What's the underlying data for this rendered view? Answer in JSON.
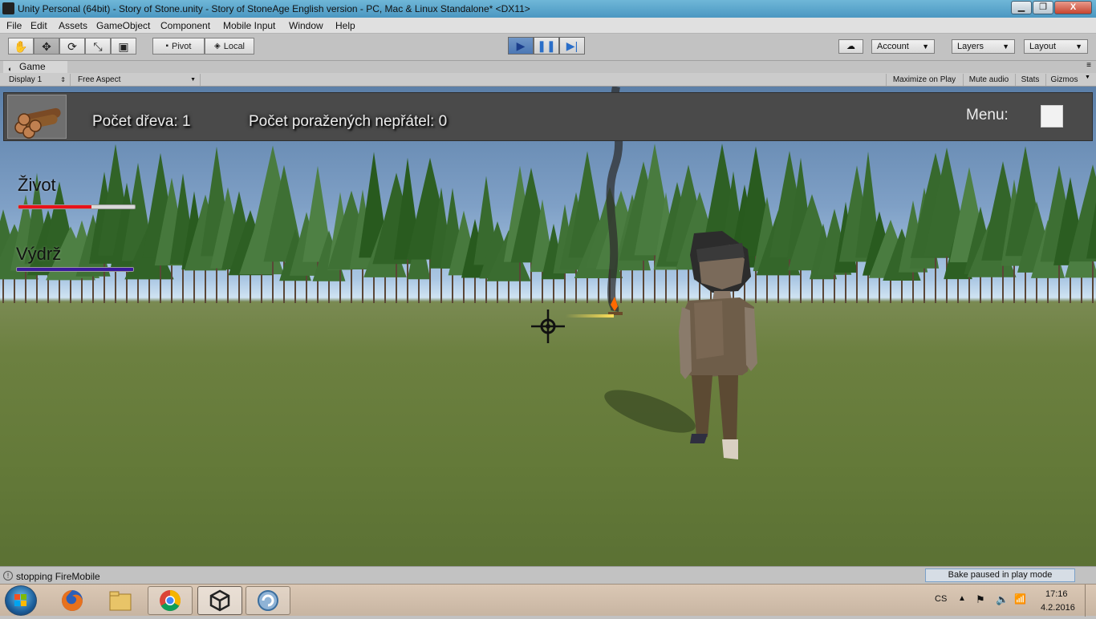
{
  "window": {
    "title": "Unity Personal (64bit) - Story of Stone.unity - Story of StoneAge English version - PC, Mac & Linux Standalone* <DX11>",
    "minimize": "▁",
    "maximize": "❐",
    "close": "X"
  },
  "menu": [
    "File",
    "Edit",
    "Assets",
    "GameObject",
    "Component",
    "Mobile Input",
    "Window",
    "Help"
  ],
  "toolbar": {
    "tools": [
      "hand-icon",
      "move-icon",
      "rotate-icon",
      "scale-icon",
      "rect-icon"
    ],
    "pivot_label": "Pivot",
    "local_label": "Local",
    "account_label": "Account",
    "layers_label": "Layers",
    "layout_label": "Layout"
  },
  "game_tab": {
    "label": "Game",
    "display": "Display 1",
    "aspect": "Free Aspect",
    "maximize_on_play": "Maximize on Play",
    "mute_audio": "Mute audio",
    "stats": "Stats",
    "gizmos": "Gizmos"
  },
  "hud": {
    "wood_count": "Počet dřeva: 1",
    "enemies_count": "Počet poražených nepřátel: 0",
    "menu_label": "Menu:"
  },
  "stats": {
    "health_label": "Život",
    "health_level": 0.63,
    "stamina_label": "Výdrž",
    "stamina_level": 1.0,
    "health_color": "#e8121a",
    "stamina_color": "#3a1a9c"
  },
  "status": {
    "message": "stopping FireMobile",
    "bake": "Bake paused in play mode"
  },
  "taskbar": {
    "lang": "CS",
    "time": "17:16",
    "date": "4.2.2016"
  },
  "colors": {
    "play_blue": "#2a6ec8",
    "hud_bg": "#4a4a4a"
  }
}
